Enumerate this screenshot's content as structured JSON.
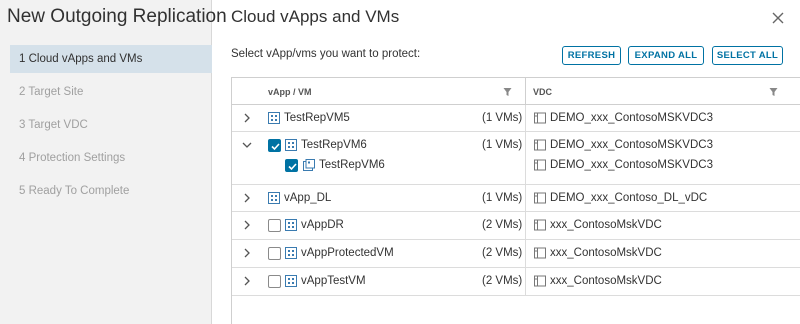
{
  "wizard": {
    "title": "New Outgoing Replication",
    "steps": [
      {
        "label": "1 Cloud vApps and VMs",
        "active": true
      },
      {
        "label": "2 Target Site",
        "active": false
      },
      {
        "label": "3 Target VDC",
        "active": false
      },
      {
        "label": "4 Protection Settings",
        "active": false
      },
      {
        "label": "5 Ready To Complete",
        "active": false
      }
    ]
  },
  "page": {
    "title": "Cloud vApps and VMs",
    "instruction": "Select vApp/vms you want to protect:"
  },
  "toolbar": {
    "refresh_label": "REFRESH",
    "expand_all_label": "EXPAND ALL",
    "select_all_label": "SELECT ALL"
  },
  "grid": {
    "columns": {
      "vapp": "vApp / VM",
      "vdc": "VDC"
    },
    "rows": [
      {
        "name": "TestRepVM5",
        "count": "(1 VMs)",
        "vdc": "DEMO_xxx_ContosoMSKVDC3",
        "expanded": false,
        "checkbox": false
      },
      {
        "name": "TestRepVM6",
        "count": "(1 VMs)",
        "vdc": "DEMO_xxx_ContosoMSKVDC3",
        "expanded": true,
        "checkbox": true,
        "checked": true,
        "children": [
          {
            "name": "TestRepVM6",
            "vdc": "DEMO_xxx_ContosoMSKVDC3",
            "checked": true
          }
        ]
      },
      {
        "name": "vApp_DL",
        "count": "(1 VMs)",
        "vdc": "DEMO_xxx_Contoso_DL_vDC",
        "expanded": false,
        "checkbox": false
      },
      {
        "name": "vAppDR",
        "count": "(2 VMs)",
        "vdc": "xxx_ContosoMskVDC",
        "expanded": false,
        "checkbox": true,
        "checked": false
      },
      {
        "name": "vAppProtectedVM",
        "count": "(2 VMs)",
        "vdc": "xxx_ContosoMskVDC",
        "expanded": false,
        "checkbox": true,
        "checked": false
      },
      {
        "name": "vAppTestVM",
        "count": "(2 VMs)",
        "vdc": "xxx_ContosoMskVDC",
        "expanded": false,
        "checkbox": true,
        "checked": false
      }
    ]
  },
  "colors": {
    "accent": "#0072a3",
    "active_step_bg": "#d5e1ea",
    "panel_bg": "#f2f2f2"
  }
}
